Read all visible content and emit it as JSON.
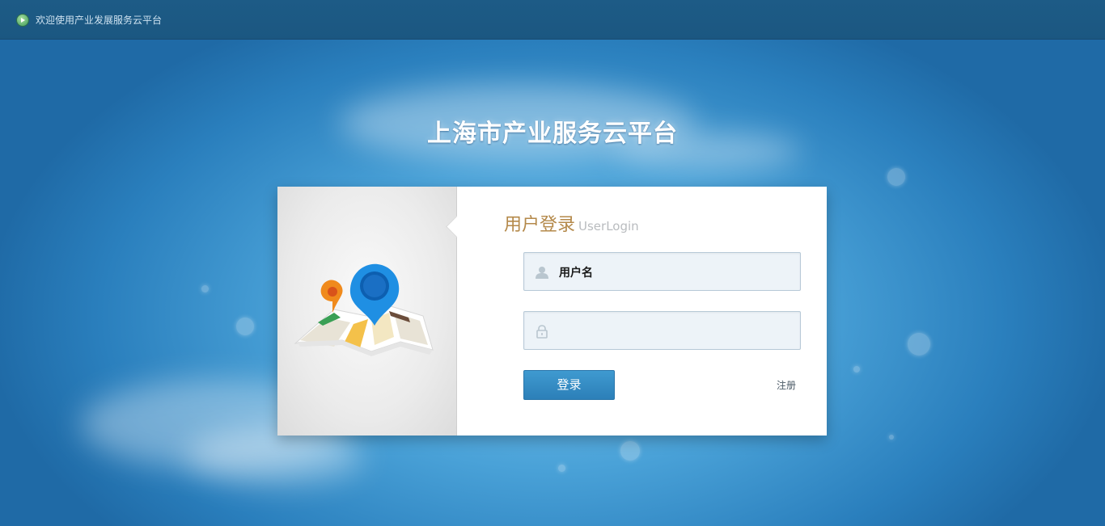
{
  "topbar": {
    "welcome_text": "欢迎使用产业发展服务云平台",
    "icon": "play-circle-icon"
  },
  "header": {
    "platform_title": "上海市产业服务云平台"
  },
  "login": {
    "title_cn": "用户登录",
    "title_en": "UserLogin",
    "username_value": "用户名",
    "password_value": "",
    "username_icon": "user-icon",
    "password_icon": "lock-icon",
    "login_button": "登录",
    "register_link": "注册"
  },
  "colors": {
    "topbar": "#1d5b86",
    "background": "#4aa2d8",
    "title_accent": "#b4894a",
    "button": "#3f9ad0",
    "field_bg": "#edf3f8"
  }
}
